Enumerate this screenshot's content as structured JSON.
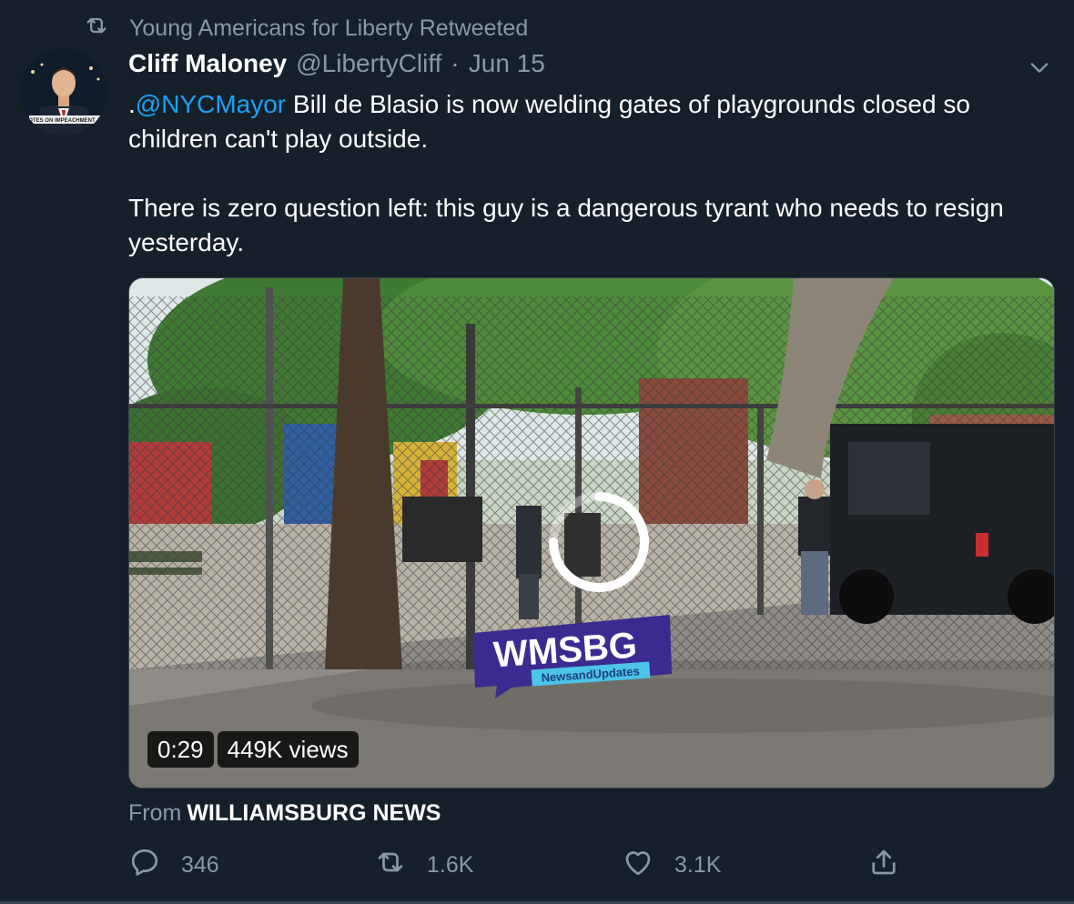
{
  "retweet_banner": {
    "text": "Young Americans for Liberty Retweeted"
  },
  "tweet": {
    "display_name": "Cliff Maloney",
    "handle": "@LibertyCliff",
    "separator": "·",
    "date": "Jun 15",
    "mention": "@NYCMayor",
    "text_line1_prefix": ".",
    "text_line1_rest": " Bill de Blasio is now welding gates of playgrounds closed so children can't play outside.",
    "text_paragraph2": "There is zero question left: this guy is a dangerous tyrant who needs to resign yesterday.",
    "avatar_caption": "VOTES ON IMPEACHMENT AR"
  },
  "media": {
    "duration": "0:29",
    "views": "449K views",
    "logo_text": "WMSBG",
    "logo_subtext": "NewsandUpdates"
  },
  "source": {
    "prefix": "From",
    "name": "WILLIAMSBURG NEWS"
  },
  "actions": {
    "reply_count": "346",
    "retweet_count": "1.6K",
    "like_count": "3.1K"
  },
  "colors": {
    "background": "#15202b",
    "accent": "#1da1f2",
    "muted": "#8899a6",
    "logo": "#3b2a8f"
  },
  "icons": [
    "retweet-icon",
    "chevron-down-icon",
    "reply-icon",
    "like-icon",
    "share-icon",
    "loading-spinner-icon"
  ]
}
